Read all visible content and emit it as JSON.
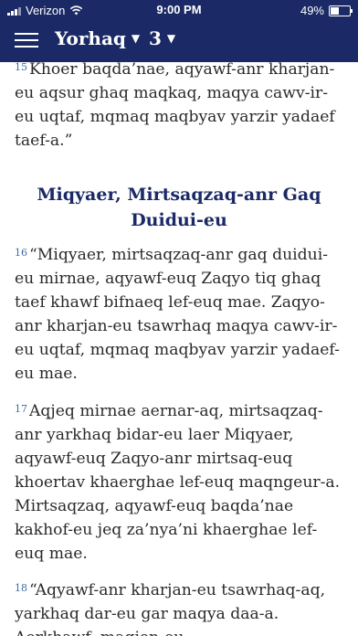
{
  "status_bar": {
    "carrier": "Verizon",
    "time": "9:00 PM",
    "battery": "49%"
  },
  "nav": {
    "book": "Yorhaq",
    "chapter": "3"
  },
  "content": {
    "v15": {
      "num": "15",
      "text": "Khoer baqda’nae, aqyawf-anr kharjan-eu aqsur ghaq maqkaq, maqya cawv-ir-eu uqtaf, mqmaq maqbyav yarzir yadaef taef-a.”"
    },
    "heading": "Miqyaer, Mirtsaqzaq-anr Gaq Duidui-eu",
    "v16": {
      "num": "16",
      "text": "“Miqyaer, mirtsaqzaq-anr gaq duidui-eu mirnae, aqyawf-euq Zaqyo tiq ghaq taef khawf bifnaeq lef-euq mae. Zaqyo-anr kharjan-eu tsawrhaq maqya cawv-ir-eu uqtaf, mqmaq maqbyav yarzir yadaef-eu mae."
    },
    "v17": {
      "num": "17",
      "text": "Aqjeq mirnae aernar-aq, mirtsaqzaq-anr yarkhaq bidar-eu laer Miqyaer, aqyawf-euq Zaqyo-anr mirtsaq-euq khoertav khaerghae lef-euq maqngeur-a. Mirtsaqzaq, aqyawf-euq baqda’nae kakhof-eu jeq za’nya’ni khaerghae lef-euq mae."
    },
    "v18": {
      "num": "18",
      "text": "“Aqyawf-anr kharjan-eu tsawrhaq-aq, yarkhaq dar-eu gar maqya daa-a. Aerkhawf, maqjon-eu"
    }
  }
}
